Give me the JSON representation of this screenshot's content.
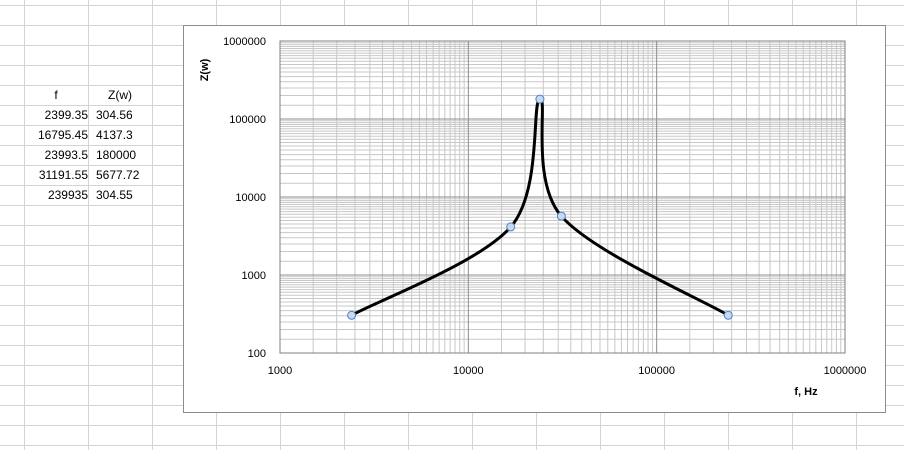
{
  "table": {
    "headers": [
      "f",
      "Z(w)"
    ],
    "rows": [
      [
        "2399.35",
        "304.56"
      ],
      [
        "16795.45",
        "4137.3"
      ],
      [
        "23993.5",
        "180000"
      ],
      [
        "31191.55",
        "5677.72"
      ],
      [
        "239935",
        "304.55"
      ]
    ]
  },
  "chart_data": {
    "type": "scatter",
    "xlabel": "f, Hz",
    "ylabel": "Z(w)",
    "xscale": "log",
    "yscale": "log",
    "xlim": [
      1000,
      1000000
    ],
    "ylim": [
      100,
      1000000
    ],
    "xticks": [
      "1000",
      "10000",
      "100000",
      "1000000"
    ],
    "yticks": [
      "100",
      "1000",
      "10000",
      "100000",
      "1000000"
    ],
    "grid": true,
    "line_style": "smooth",
    "line_color": "#000000",
    "marker_fill": "#c6d9f1",
    "marker_stroke": "#4f81bd",
    "series": [
      {
        "x": [
          2399.35,
          16795.45,
          23993.5,
          31191.55,
          239935
        ],
        "y": [
          304.56,
          4137.3,
          180000,
          5677.72,
          304.55
        ]
      }
    ]
  }
}
